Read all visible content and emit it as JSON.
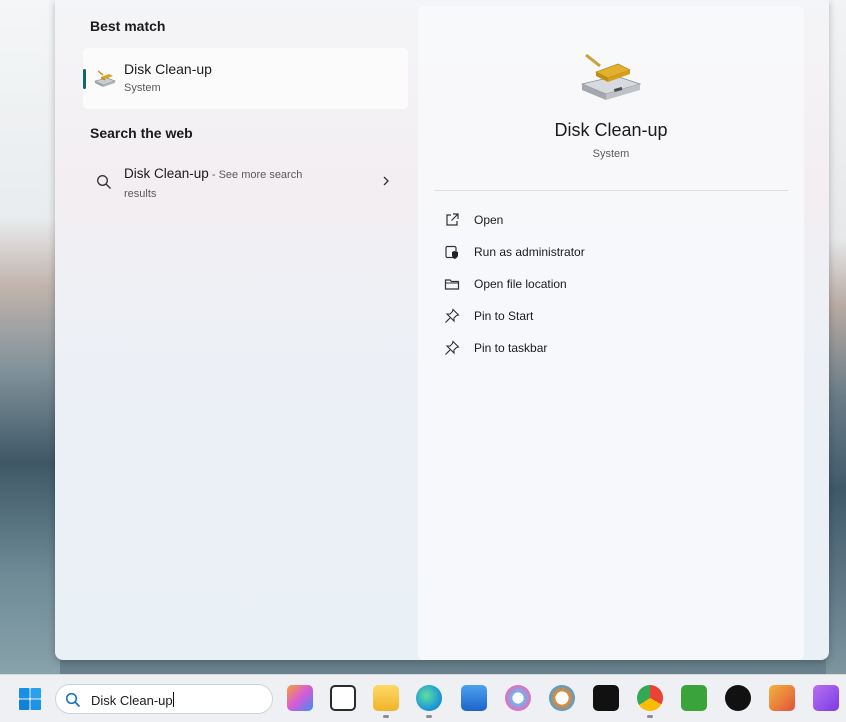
{
  "best_match": {
    "heading": "Best match",
    "title": "Disk Clean-up",
    "subtitle": "System",
    "icon": "disk-cleanup-icon"
  },
  "web": {
    "heading": "Search the web",
    "title": "Disk Clean-up",
    "suffix": " - See more search",
    "line2": "results"
  },
  "detail": {
    "title": "Disk Clean-up",
    "subtitle": "System",
    "actions": [
      {
        "label": "Open",
        "icon": "open-icon"
      },
      {
        "label": "Run as administrator",
        "icon": "shield-icon"
      },
      {
        "label": "Open file location",
        "icon": "folder-icon"
      },
      {
        "label": "Pin to Start",
        "icon": "pin-icon"
      },
      {
        "label": "Pin to taskbar",
        "icon": "pin-icon"
      }
    ]
  },
  "taskbar": {
    "search_value": "Disk Clean-up",
    "apps": [
      {
        "name": "copilot-icon",
        "color": "#d76bd6"
      },
      {
        "name": "task-view-icon",
        "color": "#2b2b2b"
      },
      {
        "name": "file-explorer-icon",
        "color": "#f5c542"
      },
      {
        "name": "edge-icon",
        "color": "#1f9bd8"
      },
      {
        "name": "mail-icon",
        "color": "#2673d6"
      },
      {
        "name": "photos-icon",
        "color": "#46a0e0"
      },
      {
        "name": "search-app-icon",
        "color": "#f08a24"
      },
      {
        "name": "capcut-icon",
        "color": "#111111"
      },
      {
        "name": "chrome-icon",
        "color": "#34a853"
      },
      {
        "name": "camtasia-icon",
        "color": "#3aa33c"
      },
      {
        "name": "tiktok-icon",
        "color": "#111111"
      },
      {
        "name": "gallery-icon",
        "color": "#e0523e"
      },
      {
        "name": "affinity-icon",
        "color": "#8a48e6"
      }
    ]
  }
}
